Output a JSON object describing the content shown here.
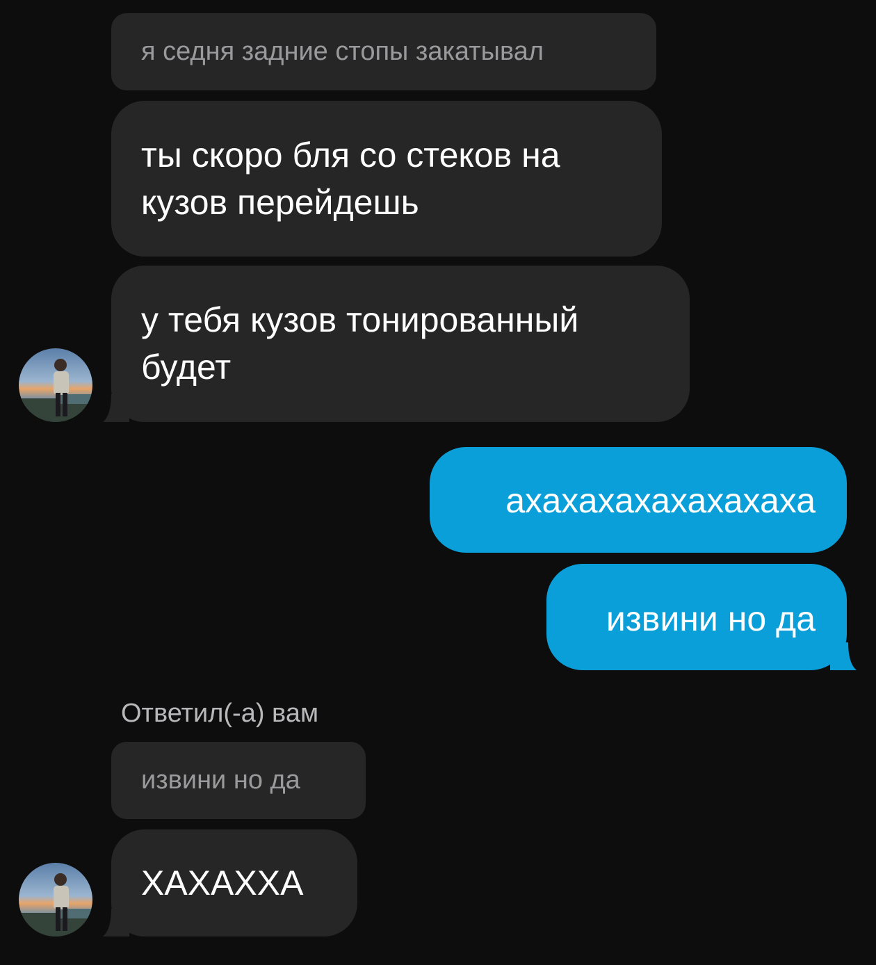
{
  "chat": {
    "messages": [
      {
        "kind": "quote",
        "text": "я седня задние стопы закатывал"
      },
      {
        "kind": "incoming",
        "text": "ты скоро бля со стеков на кузов перейдешь"
      },
      {
        "kind": "incoming",
        "text": "у тебя кузов тонированный будет"
      },
      {
        "kind": "outgoing",
        "text": "ахахахахахахахаха"
      },
      {
        "kind": "outgoing",
        "text": "извини но да"
      },
      {
        "kind": "reply-label",
        "text": "Ответил(-а) вам"
      },
      {
        "kind": "quote",
        "text": "извини но да"
      },
      {
        "kind": "incoming",
        "text": "ХАХАХХА"
      }
    ],
    "avatar_icon": "user-avatar-photo",
    "colors": {
      "background": "#0d0d0e",
      "incoming_bubble": "#262627",
      "outgoing_bubble": "#0a9fd8",
      "quote_text": "#9a9a9c"
    }
  }
}
